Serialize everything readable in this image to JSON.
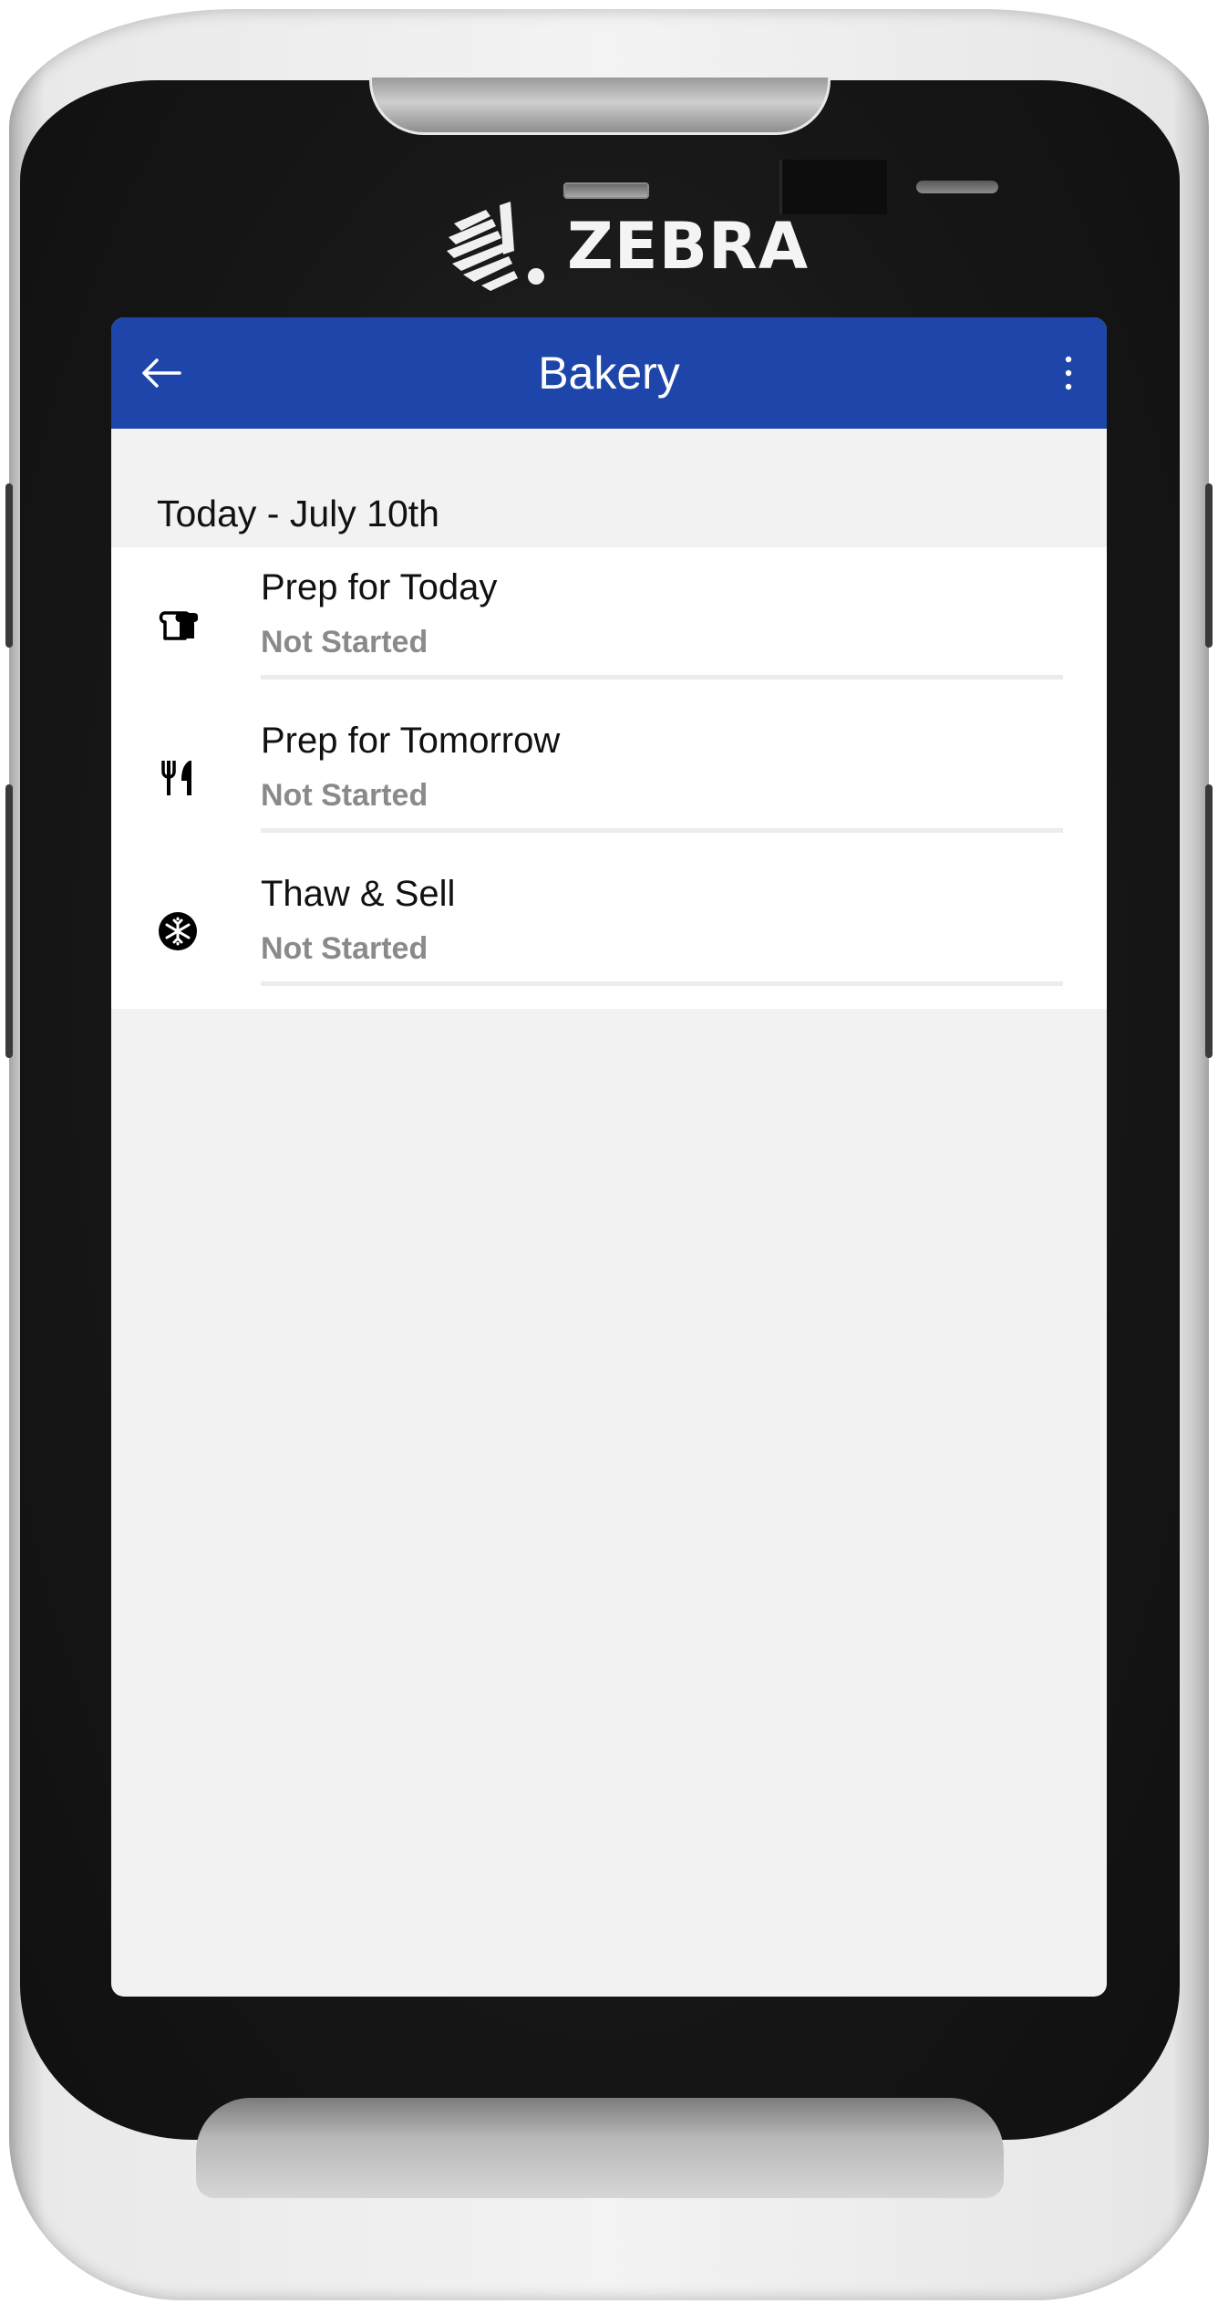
{
  "device": {
    "brand": "ZEBRA"
  },
  "app_bar": {
    "title": "Bakery",
    "background_color": "#1e45aa",
    "back_icon": "arrow-left-icon",
    "menu_icon": "more-vertical-icon"
  },
  "section": {
    "header": "Today - July 10th"
  },
  "tasks": [
    {
      "title": "Prep for Today",
      "status": "Not Started",
      "icon": "bread-icon"
    },
    {
      "title": "Prep for Tomorrow",
      "status": "Not Started",
      "icon": "fork-knife-icon"
    },
    {
      "title": "Thaw & Sell",
      "status": "Not Started",
      "icon": "snowflake-icon"
    }
  ]
}
